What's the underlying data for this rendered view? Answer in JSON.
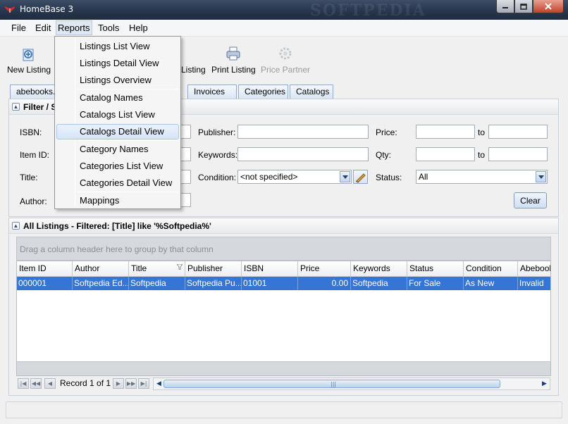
{
  "window": {
    "title": "HomeBase 3",
    "watermark": "SOFTPEDIA",
    "minimize_icon": "minimize-icon",
    "maximize_icon": "maximize-icon",
    "close_icon": "close-icon"
  },
  "menubar": {
    "items": [
      "File",
      "Edit",
      "Reports",
      "Tools",
      "Help"
    ]
  },
  "toolbar": {
    "new_listing": "New Listing",
    "listing": "Listing",
    "print_listing": "Print Listing",
    "price_partner": "Price Partner"
  },
  "tabs": [
    "abebooks.c",
    "Invoices",
    "Categories",
    "Catalogs"
  ],
  "filter": {
    "header": "Filter / S",
    "isbn_label": "ISBN:",
    "itemid_label": "Item ID:",
    "title_label": "Title:",
    "author_label": "Author:",
    "publisher_label": "Publisher:",
    "keywords_label": "Keywords:",
    "condition_label": "Condition:",
    "condition_value": "<not specified>",
    "price_label": "Price:",
    "qty_label": "Qty:",
    "to_label": "to",
    "status_label": "Status:",
    "status_value": "All",
    "clear": "Clear"
  },
  "listings": {
    "header": "All Listings - Filtered: [Title] like '%Softpedia%'",
    "group_hint": "Drag a column header here to group by that column",
    "columns": [
      "Item ID",
      "Author",
      "Title",
      "Publisher",
      "ISBN",
      "Price",
      "Keywords",
      "Status",
      "Condition",
      "Abebook"
    ],
    "rows": [
      [
        "000001",
        "Softpedia Ed...",
        "Softpedia",
        "Softpedia Pu...",
        "01001",
        "0.00",
        "Softpedia",
        "For Sale",
        "As New",
        "Invalid"
      ]
    ],
    "record_text": "Record 1 of 1"
  },
  "reports_menu": {
    "items": [
      "Listings List View",
      "Listings Detail View",
      "Listings Overview",
      "Catalog Names",
      "Catalogs List View",
      "Catalogs Detail View",
      "Category Names",
      "Categories List View",
      "Categories Detail View",
      "Mappings"
    ],
    "highlighted": "Catalogs Detail View"
  },
  "colors": {
    "selection": "#3575d3",
    "titlebar": "#2b3a52"
  }
}
